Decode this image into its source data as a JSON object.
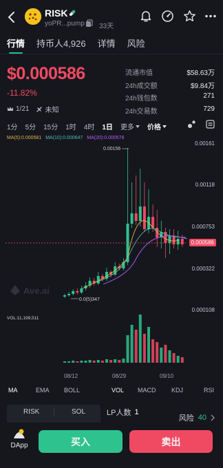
{
  "header": {
    "token_name": "RISK",
    "address": "yoPR...pump",
    "age": "33天"
  },
  "tabs": [
    {
      "label": "行情",
      "active": true
    },
    {
      "label": "持币人4,926",
      "active": false
    },
    {
      "label": "详情",
      "active": false
    },
    {
      "label": "风险",
      "active": false
    }
  ],
  "price": {
    "value": "$0.000586",
    "change": "-11.82%",
    "rank": "1/21",
    "tag": "未知"
  },
  "stats": [
    {
      "label": "流通市值",
      "value": "$58.63万"
    },
    {
      "label": "24h成交额",
      "value": "$9.84万"
    },
    {
      "label": "24h钱包数",
      "value": "271"
    },
    {
      "label": "24h交易数",
      "value": "729"
    }
  ],
  "intervals": {
    "items": [
      "1分",
      "5分",
      "15分",
      "1时",
      "4时",
      "1日"
    ],
    "selected": "1日",
    "more": "更多",
    "indicator": "价格"
  },
  "ma_legend": [
    {
      "label": "MA(5):0.000581",
      "color": "#e0b64a"
    },
    {
      "label": "MA(10):0.000647",
      "color": "#4ac0b4"
    },
    {
      "label": "MA(20):0.000578",
      "color": "#b35cff"
    }
  ],
  "chart_data": {
    "type": "candlestick",
    "price_ticks": [
      "0.00161",
      "0.00118",
      "0.000753",
      "0.000586",
      "0.000322",
      "0.000108"
    ],
    "high_label": "0.00156",
    "low_label": "0.0(5)347",
    "current_price": "0.000586",
    "volume_label": "VOL:11,199,511",
    "dates": [
      "08/12",
      "08/29",
      "09/10"
    ],
    "up_color": "#2ec28f",
    "down_color": "#f04a63"
  },
  "indicators": {
    "main": [
      "MA",
      "EMA",
      "BOLL"
    ],
    "sub": [
      "VOL",
      "MACD",
      "KDJ",
      "RSI"
    ],
    "main_selected": "MA",
    "sub_selected": "VOL"
  },
  "bottom": {
    "pair": [
      "RISK",
      "SOL"
    ],
    "lp_label": "LP人数",
    "lp_value": "1",
    "risk_label": "风险",
    "risk_value": "40",
    "dapp_label": "DApp",
    "buy_label": "买入",
    "sell_label": "卖出"
  }
}
